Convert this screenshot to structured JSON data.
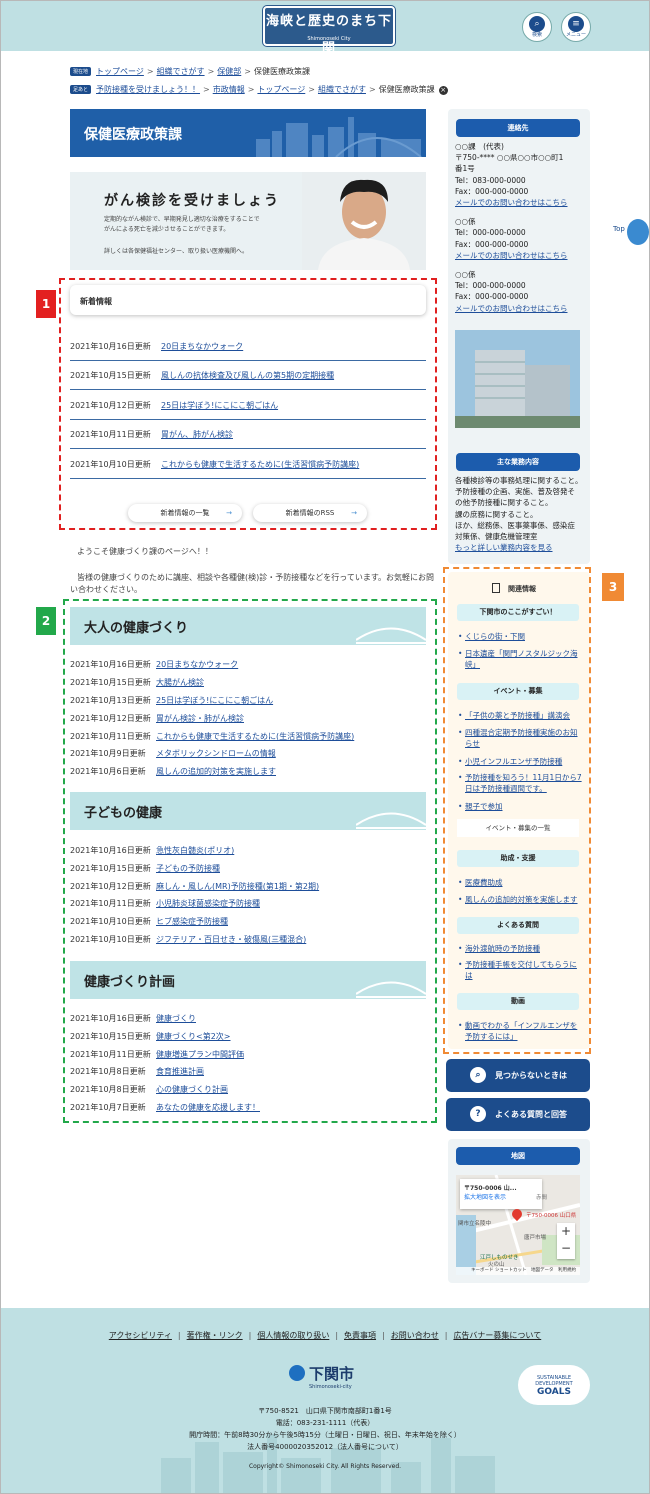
{
  "header": {
    "logo_text": "海峡と歴史のまち下関",
    "logo_sub": "Shimonoseki City",
    "search_label": "検索",
    "menu_label": "メニュー"
  },
  "breadcrumb": {
    "current_tag": "現在地",
    "current_items": [
      "トップページ",
      "組織でさがす",
      "保健部"
    ],
    "current_page": "保健医療政策課",
    "history_tag": "足あと",
    "history_items": [
      "予防接種を受けましょう！！",
      "市政情報",
      "トップページ",
      "組織でさがす"
    ],
    "history_page": "保健医療政策課"
  },
  "page_title": "保健医療政策課",
  "banner": {
    "title": "がん検診を受けましょう",
    "line1": "定期的ながん検診で、早期発見し適切な治療をすることで",
    "line2": "がんによる死亡を減少させることができます。",
    "line3": "詳しくは各保健福祉センター、取り扱い医療機関へ。"
  },
  "annotations": {
    "n1": "1",
    "n2": "2",
    "n3": "3"
  },
  "news": {
    "title": "新着情報",
    "items": [
      {
        "date": "2021年10月16日更新",
        "text": "20日まちなかウォーク"
      },
      {
        "date": "2021年10月15日更新",
        "text": "風しんの抗体検査及び風しんの第5期の定期接種"
      },
      {
        "date": "2021年10月12日更新",
        "text": "25日は学ぼう!にこにこ朝ごはん"
      },
      {
        "date": "2021年10月11日更新",
        "text": "胃がん、肺がん検診"
      },
      {
        "date": "2021年10月10日更新",
        "text": "これからも健康で生活するために(生活習慣病予防講座)"
      }
    ],
    "list_btn": "新着情報の一覧",
    "rss_btn": "新着情報のRSS"
  },
  "intro": {
    "line1": "ようこそ健康づくり課のページへ！！",
    "line2": "皆様の健康づくりのために講座、相談や各種健(検)診・予防接種などを行っています。お気軽にお問",
    "line3": "い合わせください。"
  },
  "sections": [
    {
      "title": "大人の健康づくり",
      "items": [
        {
          "date": "2021年10月16日更新",
          "text": "20日まちなかウォーク"
        },
        {
          "date": "2021年10月15日更新",
          "text": "大腸がん検診"
        },
        {
          "date": "2021年10月13日更新",
          "text": "25日は学ぼう!にこにこ朝ごはん"
        },
        {
          "date": "2021年10月12日更新",
          "text": "胃がん検診・肺がん検診"
        },
        {
          "date": "2021年10月11日更新",
          "text": "これからも健康で生活するために(生活習慣病予防講座)"
        },
        {
          "date": "2021年10月9日更新",
          "text": "メタボリックシンドロームの情報"
        },
        {
          "date": "2021年10月6日更新",
          "text": "風しんの追加的対策を実施します"
        }
      ]
    },
    {
      "title": "子どもの健康",
      "items": [
        {
          "date": "2021年10月16日更新",
          "text": "急性灰白髄炎(ポリオ)"
        },
        {
          "date": "2021年10月15日更新",
          "text": "子どもの予防接種"
        },
        {
          "date": "2021年10月12日更新",
          "text": "麻しん・風しん(MR)予防接種(第1期・第2期)"
        },
        {
          "date": "2021年10月11日更新",
          "text": "小児肺炎球菌感染症予防接種"
        },
        {
          "date": "2021年10月10日更新",
          "text": "ヒブ感染症予防接種"
        },
        {
          "date": "2021年10月10日更新",
          "text": "ジフテリア・百日せき・破傷風(三種混合)"
        }
      ]
    },
    {
      "title": "健康づくり計画",
      "items": [
        {
          "date": "2021年10月16日更新",
          "text": "健康づくり"
        },
        {
          "date": "2021年10月15日更新",
          "text": "健康づくり<第2次>"
        },
        {
          "date": "2021年10月11日更新",
          "text": "健康増進プラン中間評価"
        },
        {
          "date": "2021年10月8日更新",
          "text": "食育推進計画"
        },
        {
          "date": "2021年10月8日更新",
          "text": "心の健康づくり計画"
        },
        {
          "date": "2021年10月7日更新",
          "text": "あなたの健康を応援します！"
        }
      ]
    }
  ],
  "contact": {
    "title": "連絡先",
    "main": {
      "name": "○○課　(代表)",
      "addr1": "〒750-**** ○○県○○市○○町1",
      "addr2": "番1号",
      "tel": "Tel：083-000-0000",
      "fax": "Fax：000-000-0000",
      "mail": "メールでのお問い合わせはこちら"
    },
    "sub": [
      {
        "name": "○○係",
        "tel": "Tel：000-000-0000",
        "fax": "Fax：000-000-0000",
        "mail": "メールでのお問い合わせはこちら"
      },
      {
        "name": "○○係",
        "tel": "Tel：000-000-0000",
        "fax": "Fax：000-000-0000",
        "mail": "メールでのお問い合わせはこちら"
      }
    ]
  },
  "business": {
    "title": "主な業務内容",
    "lines": [
      "各種検診等の事務処理に関すること。",
      "予防接種の企画、実施、普及啓発そ",
      "の他予防接種に関すること。",
      "課の庶務に関すること。",
      "ほか、総務係、医事薬事係、感染症",
      "対策係、健康危機管理室"
    ],
    "more": "もっと詳しい業務内容を見る"
  },
  "related": {
    "title": "関連情報",
    "groups": [
      {
        "heading": "下関市のここがすごい！",
        "items": [
          "くじらの街・下関",
          "日本遺産「関門ノスタルジック海峡」"
        ]
      },
      {
        "heading": "イベント・募集",
        "items": [
          "「子供の薬と予防接種」講演会",
          "四種混合定期予防接種実施のお知らせ",
          "小児インフルエンザ予防接種",
          "予防接種を知ろう！11月1日から7日は予防接種週間です。",
          "親子で参加"
        ],
        "more": "イベント・募集の一覧"
      },
      {
        "heading": "助成・支援",
        "items": [
          "医療費助成",
          "風しんの追加的対策を実施します"
        ]
      },
      {
        "heading": "よくある質問",
        "items": [
          "海外渡航時の予防接種",
          "予防接種手帳を交付してもらうには"
        ]
      },
      {
        "heading": "動画",
        "items": [
          "動画でわかる「インフルエンザを予防するには」"
        ]
      }
    ]
  },
  "buttons": {
    "not_found": "見つからないときは",
    "faq": "よくある質問と回答"
  },
  "map": {
    "title": "地図",
    "card_title": "〒750-0006 山...",
    "card_link": "拡大地図を表示",
    "pin_label": "〒750-0006 山口県",
    "place1": "赤間",
    "place2": "関市立名陵中",
    "place3": "唐戸市場",
    "place4": "江戸しものせき",
    "place5": "火の山",
    "footer": "キーボード ショートカット　地図データ　利用規約"
  },
  "top_tab": "Top",
  "footer": {
    "links": [
      "アクセシビリティ",
      "著作権・リンク",
      "個人情報の取り扱い",
      "免責事項",
      "お問い合わせ",
      "広告バナー募集について"
    ],
    "city": "下関市",
    "city_en": "Shimonoseki-city",
    "sdg1": "SUSTAINABLE",
    "sdg2": "DEVELOPMENT",
    "sdg3": "GOALS",
    "addr": "〒750-8521　山口県下関市南部町1番1号",
    "tel": "電話：083-231-1111（代表）",
    "hours": "開庁時間：午前8時30分から午後5時15分（土曜日・日曜日、祝日、年末年始を除く）",
    "corp": "法人番号4000020352012（法人番号について）",
    "copyright": "Copyright© Shimonoseki City. All Rights Reserved."
  }
}
